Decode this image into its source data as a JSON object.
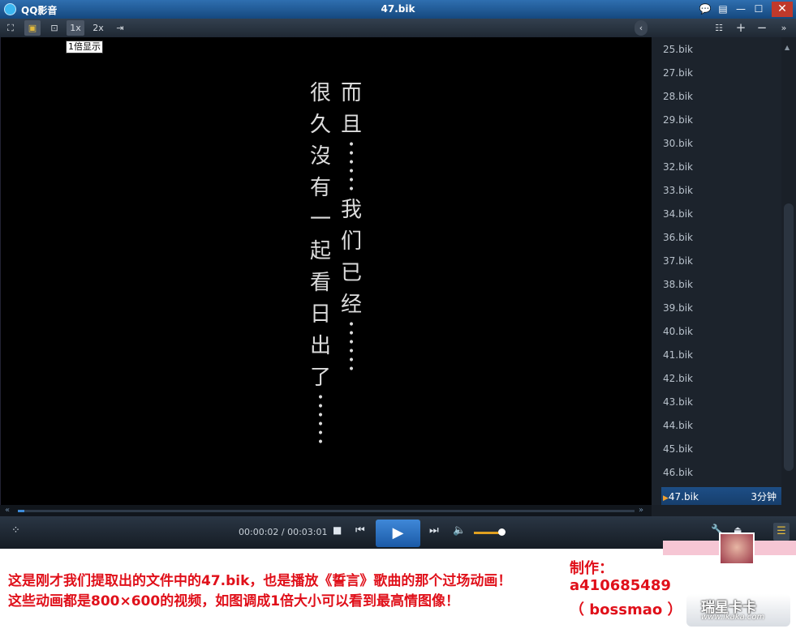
{
  "window": {
    "app_name": "QQ影音",
    "title": "47.bik",
    "controls": {
      "chat": "💬",
      "menu": "▤",
      "minimize": "—",
      "maximize": "☐",
      "close": "✕"
    }
  },
  "toolbar": {
    "zoom_1x": "1x",
    "zoom_2x": "2x",
    "tooltip": "1倍显示",
    "collapse": "‹",
    "list": "☷",
    "add": "+",
    "remove": "−",
    "more": "»"
  },
  "video": {
    "right_column": [
      "而",
      "且"
    ],
    "right_column_2": [
      "我",
      "们",
      "已",
      "经"
    ],
    "left_column": [
      "很",
      "久",
      "沒",
      "有",
      "一",
      "起",
      "看",
      "日",
      "出",
      "了"
    ]
  },
  "playlist": {
    "items": [
      "25.bik",
      "27.bik",
      "28.bik",
      "29.bik",
      "30.bik",
      "32.bik",
      "33.bik",
      "34.bik",
      "36.bik",
      "37.bik",
      "38.bik",
      "39.bik",
      "40.bik",
      "41.bik",
      "42.bik",
      "43.bik",
      "44.bik",
      "45.bik",
      "46.bik"
    ],
    "current": {
      "name": "47.bik",
      "duration": "3分钟"
    }
  },
  "player": {
    "time_display": "00:00:02 / 00:03:01",
    "progress_fraction": 0.011,
    "volume_fraction": 0.8
  },
  "caption": {
    "line1": "这是刚才我们提取出的文件中的47.bik，也是播放《誓言》歌曲的那个过场动画！",
    "line2": "这些动画都是800×600的视频，如图调成1倍大小可以看到最高情图像！",
    "credit_label": "制作：",
    "credit_id": "a410685489",
    "credit_name": "（ bossmao ）"
  },
  "watermark": {
    "main": "瑞星卡卡",
    "url": "www.ikaka.com"
  },
  "colors": {
    "accent": "#1b5aa7",
    "caption": "#e0101a",
    "titlebar": "#2f6fb0"
  }
}
